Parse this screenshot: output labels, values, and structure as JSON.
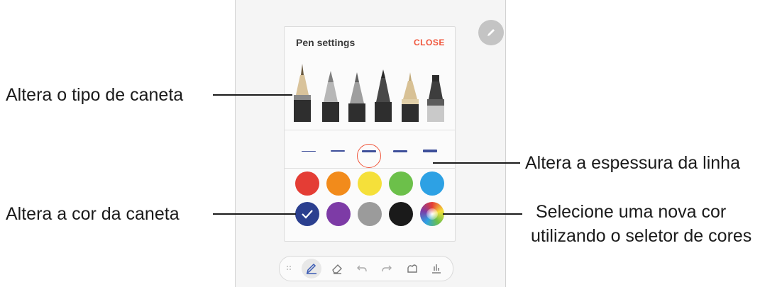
{
  "pen_settings": {
    "title": "Pen settings",
    "close_label": "CLOSE"
  },
  "pen_types": [
    "fountain-pen",
    "calligraphy-pen",
    "pencil",
    "marker",
    "brush-pen",
    "highlighter"
  ],
  "line_thickness_levels": [
    1,
    2,
    3,
    4,
    5
  ],
  "line_thickness_selected": 3,
  "colors": {
    "row1": [
      "#e43d35",
      "#f28b1b",
      "#f5e03a",
      "#6cc04a",
      "#2da1e4"
    ],
    "row2": [
      "#2b3f8f",
      "#7d3ba6",
      "#9b9b9b",
      "#1a1a1a",
      "color-picker"
    ],
    "selected": "#2b3f8f",
    "accent": "#f0563c"
  },
  "toolbar_icons": [
    "drag-handle-icon",
    "pen-icon",
    "eraser-icon",
    "undo-icon",
    "redo-icon",
    "shape-icon",
    "save-icon"
  ],
  "annotations": {
    "pen_type": "Altera o tipo de caneta",
    "line_thickness": "Altera a espessura da linha",
    "pen_color": "Altera a cor da caneta",
    "color_picker_line1": "Selecione uma nova cor",
    "color_picker_line2": "utilizando o seletor de cores"
  }
}
